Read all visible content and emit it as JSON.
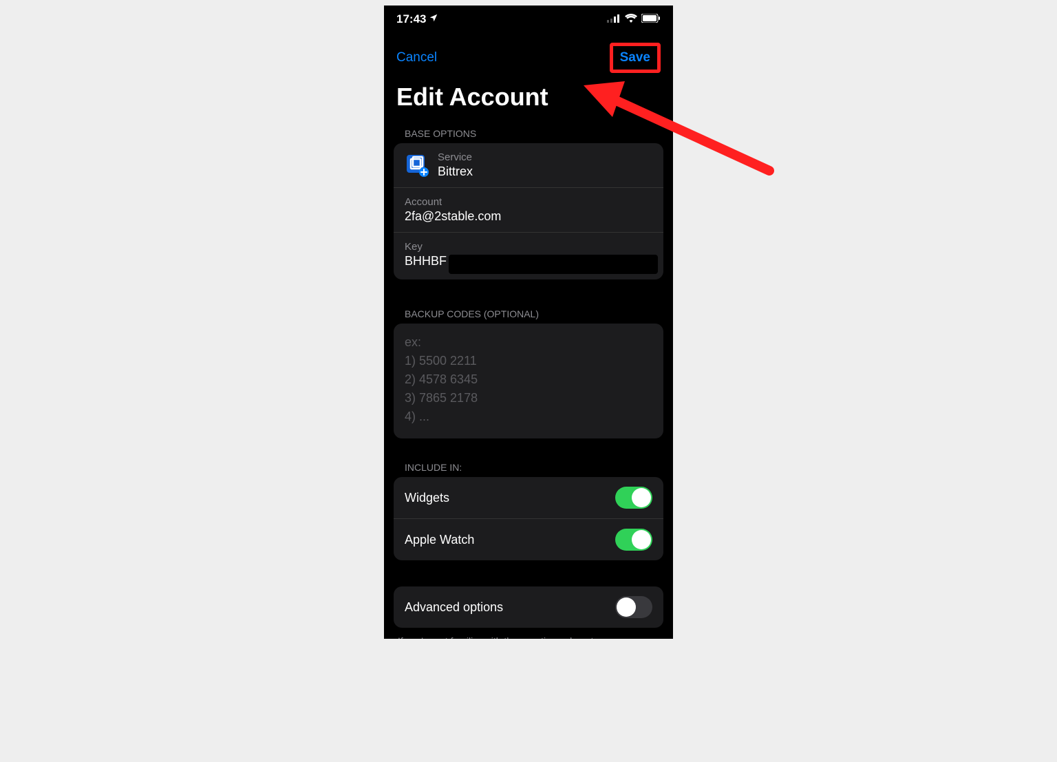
{
  "status": {
    "time": "17:43"
  },
  "nav": {
    "cancel": "Cancel",
    "save": "Save"
  },
  "title": "Edit Account",
  "sections": {
    "base": {
      "header": "BASE OPTIONS",
      "service": {
        "label": "Service",
        "value": "Bittrex"
      },
      "account": {
        "label": "Account",
        "value": "2fa@2stable.com"
      },
      "key": {
        "label": "Key",
        "value": "BHHBF"
      }
    },
    "backup": {
      "header": "BACKUP CODES (OPTIONAL)",
      "placeholder": "ex:\n1) 5500 2211\n2) 4578 6345\n3) 7865 2178\n4) ..."
    },
    "include": {
      "header": "INCLUDE IN:",
      "widgets": {
        "label": "Widgets",
        "on": true
      },
      "apple_watch": {
        "label": "Apple Watch",
        "on": true
      }
    },
    "advanced": {
      "label": "Advanced options",
      "on": false,
      "footer": "If you're not familiar with these options, do not"
    }
  },
  "colors": {
    "accent": "#0a84ff",
    "highlight": "#ff2020",
    "toggle_on": "#30d158"
  }
}
